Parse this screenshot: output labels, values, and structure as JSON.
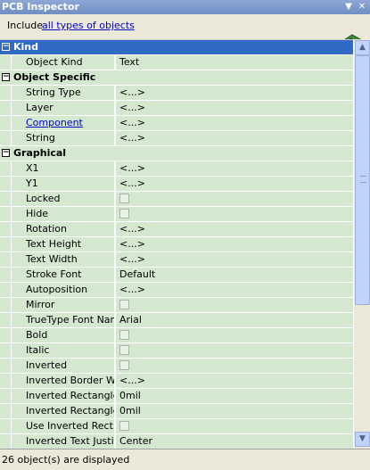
{
  "window": {
    "title": "PCB Inspector"
  },
  "include": {
    "prefix": "Include",
    "link": "all types of objects"
  },
  "categories": [
    {
      "label": "Kind",
      "selected": true,
      "rows": [
        {
          "name": "Object Kind",
          "value": "Text",
          "type": "text"
        }
      ]
    },
    {
      "label": "Object Specific",
      "selected": false,
      "rows": [
        {
          "name": "String Type",
          "value": "<...>",
          "type": "text"
        },
        {
          "name": "Layer",
          "value": "<...>",
          "type": "text"
        },
        {
          "name": "Component",
          "value": "<...>",
          "type": "text",
          "link": true
        },
        {
          "name": "String",
          "value": "<...>",
          "type": "text"
        }
      ]
    },
    {
      "label": "Graphical",
      "selected": false,
      "rows": [
        {
          "name": "X1",
          "value": "<...>",
          "type": "text"
        },
        {
          "name": "Y1",
          "value": "<...>",
          "type": "text"
        },
        {
          "name": "Locked",
          "value": "",
          "type": "checkbox"
        },
        {
          "name": "Hide",
          "value": "",
          "type": "checkbox"
        },
        {
          "name": "Rotation",
          "value": "<...>",
          "type": "text"
        },
        {
          "name": "Text Height",
          "value": "<...>",
          "type": "text"
        },
        {
          "name": "Text Width",
          "value": "<...>",
          "type": "text"
        },
        {
          "name": "Stroke Font",
          "value": "Default",
          "type": "text"
        },
        {
          "name": "Autoposition",
          "value": "<...>",
          "type": "text"
        },
        {
          "name": "Mirror",
          "value": "",
          "type": "checkbox"
        },
        {
          "name": "TrueType Font Name",
          "value": "Arial",
          "type": "text"
        },
        {
          "name": "Bold",
          "value": "",
          "type": "checkbox"
        },
        {
          "name": "Italic",
          "value": "",
          "type": "checkbox"
        },
        {
          "name": "Inverted",
          "value": "",
          "type": "checkbox"
        },
        {
          "name": "Inverted Border Wi...",
          "value": "<...>",
          "type": "text"
        },
        {
          "name": "Inverted Rectangle...",
          "value": "0mil",
          "type": "text"
        },
        {
          "name": "Inverted Rectangle...",
          "value": "0mil",
          "type": "text"
        },
        {
          "name": "Use Inverted Rect...",
          "value": "",
          "type": "checkbox"
        },
        {
          "name": "Inverted Text Justifi...",
          "value": "Center",
          "type": "text"
        }
      ]
    }
  ],
  "status": {
    "text": "26 object(s) are displayed"
  },
  "icons": {
    "pin": "pin-down-icon",
    "close": "close-icon",
    "pcb": "pcb-board-icon"
  },
  "colors": {
    "row_bg": "#d4e8d0",
    "selected_bg": "#316ac5",
    "link": "#0000cc"
  }
}
